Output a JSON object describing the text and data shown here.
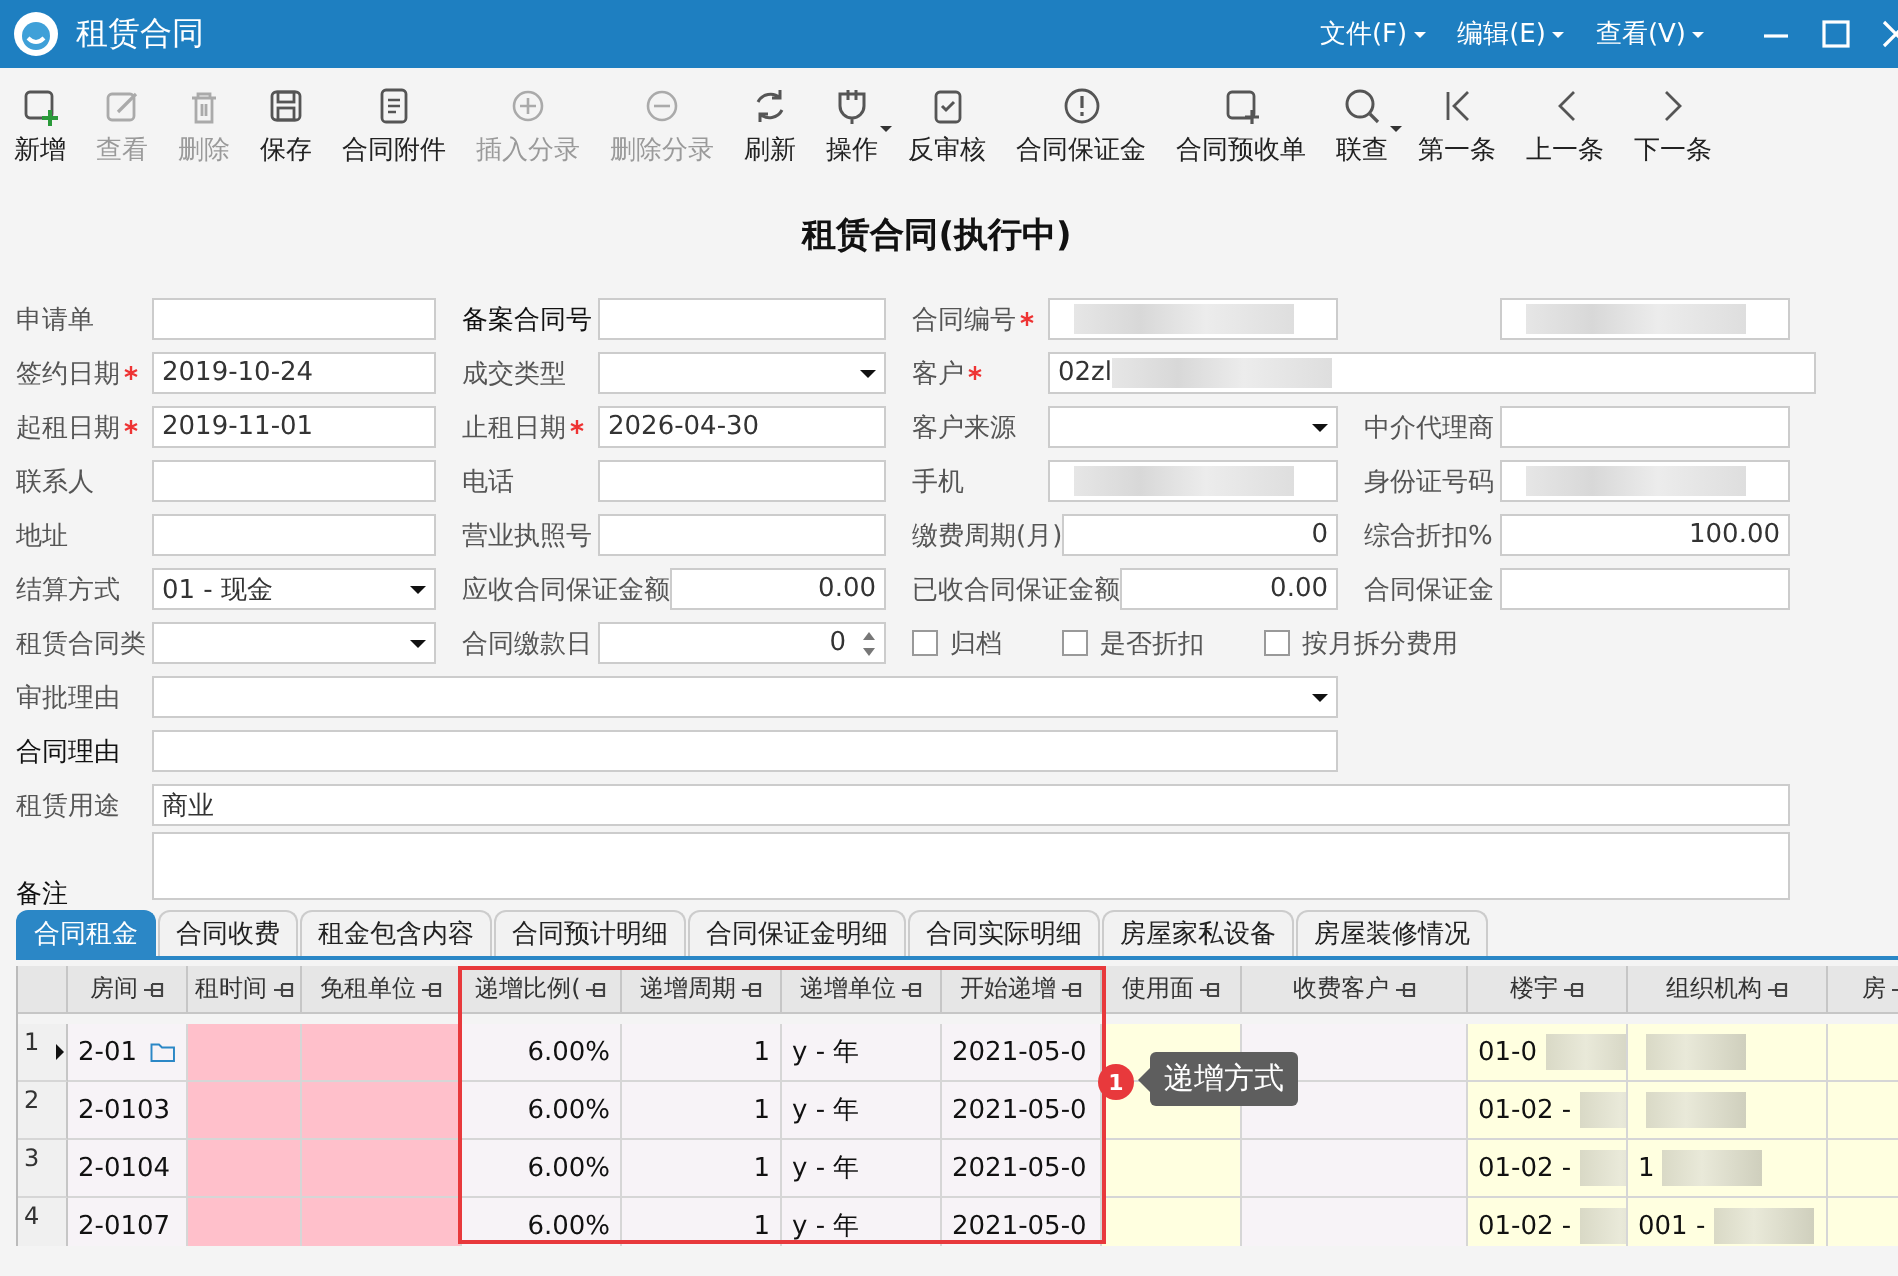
{
  "window": {
    "title": "租赁合同",
    "menus": [
      "文件(F)",
      "编辑(E)",
      "查看(V)"
    ]
  },
  "toolbar": [
    {
      "label": "新增",
      "disabled": false,
      "dropdown": false
    },
    {
      "label": "查看",
      "disabled": true,
      "dropdown": false
    },
    {
      "label": "删除",
      "disabled": true,
      "dropdown": false
    },
    {
      "label": "保存",
      "disabled": false,
      "dropdown": false
    },
    {
      "label": "合同附件",
      "disabled": false,
      "dropdown": false
    },
    {
      "label": "插入分录",
      "disabled": true,
      "dropdown": false
    },
    {
      "label": "删除分录",
      "disabled": true,
      "dropdown": false
    },
    {
      "label": "刷新",
      "disabled": false,
      "dropdown": false
    },
    {
      "label": "操作",
      "disabled": false,
      "dropdown": true
    },
    {
      "label": "反审核",
      "disabled": false,
      "dropdown": false
    },
    {
      "label": "合同保证金",
      "disabled": false,
      "dropdown": false
    },
    {
      "label": "合同预收单",
      "disabled": false,
      "dropdown": false
    },
    {
      "label": "联查",
      "disabled": false,
      "dropdown": true
    },
    {
      "label": "第一条",
      "disabled": false,
      "dropdown": false
    },
    {
      "label": "上一条",
      "disabled": false,
      "dropdown": false
    },
    {
      "label": "下一条",
      "disabled": false,
      "dropdown": false
    }
  ],
  "heading": "租赁合同(执行中)",
  "form": [
    [
      {
        "label": "申请单",
        "kind": "text"
      },
      {
        "label": "备案合同号",
        "kind": "text",
        "strong": true
      },
      {
        "label": "合同编号",
        "kind": "text",
        "required": true,
        "redacted": true
      },
      {
        "kind": "text",
        "redacted": true
      }
    ],
    [
      {
        "label": "签约日期",
        "kind": "text",
        "required": true,
        "value": "2019-10-24"
      },
      {
        "label": "成交类型",
        "kind": "select"
      },
      {
        "label": "客户",
        "kind": "text",
        "required": true,
        "value": "02zl",
        "redacted": true
      }
    ],
    [
      {
        "label": "起租日期",
        "kind": "text",
        "required": true,
        "value": "2019-11-01"
      },
      {
        "label": "止租日期",
        "kind": "text",
        "required": true,
        "value": "2026-04-30"
      },
      {
        "label": "客户来源",
        "kind": "select"
      },
      {
        "label": "中介代理商",
        "kind": "text"
      }
    ],
    [
      {
        "label": "联系人",
        "kind": "text"
      },
      {
        "label": "电话",
        "kind": "text"
      },
      {
        "label": "手机",
        "kind": "text",
        "redacted": true
      },
      {
        "label": "身份证号码",
        "kind": "text",
        "redacted": true
      }
    ],
    [
      {
        "label": "地址",
        "kind": "text"
      },
      {
        "label": "营业执照号",
        "kind": "text"
      },
      {
        "label": "缴费周期(月)",
        "kind": "number",
        "value": "0"
      },
      {
        "label": "综合折扣%",
        "kind": "number",
        "value": "100.00"
      }
    ],
    [
      {
        "label": "结算方式",
        "kind": "select",
        "value": "01 - 现金"
      },
      {
        "label": "应收合同保证金额",
        "kind": "number",
        "value": "0.00"
      },
      {
        "label": "已收合同保证金额",
        "kind": "number",
        "value": "0.00"
      },
      {
        "label": "合同保证金",
        "kind": "text"
      }
    ],
    [
      {
        "label": "租赁合同类",
        "kind": "select"
      },
      {
        "label": "合同缴款日",
        "kind": "spin",
        "value": "0"
      },
      {
        "kind": "checks",
        "items": [
          {
            "label": "归档",
            "checked": false
          },
          {
            "label": "是否折扣",
            "checked": false
          },
          {
            "label": "按月拆分费用",
            "checked": false
          }
        ]
      }
    ],
    [
      {
        "label": "审批理由",
        "kind": "select"
      }
    ],
    [
      {
        "label": "合同理由",
        "kind": "text",
        "strong": true
      }
    ],
    [
      {
        "label": "租赁用途",
        "kind": "text",
        "value": "商业"
      }
    ],
    [
      {
        "label": "备注",
        "kind": "textarea",
        "strong": true
      }
    ]
  ],
  "tabs": [
    {
      "label": "合同租金",
      "selected": true
    },
    {
      "label": "合同收费",
      "selected": false
    },
    {
      "label": "租金包含内容",
      "selected": false
    },
    {
      "label": "合同预计明细",
      "selected": false
    },
    {
      "label": "合同保证金明细",
      "selected": false
    },
    {
      "label": "合同实际明细",
      "selected": false
    },
    {
      "label": "房屋家私设备",
      "selected": false
    },
    {
      "label": "房屋装修情况",
      "selected": false
    }
  ],
  "grid": {
    "columns": [
      {
        "header": "房间",
        "color": "#f7f3f7"
      },
      {
        "header": "租时间",
        "color": "#ffc0cb"
      },
      {
        "header": "免租单位",
        "color": "#ffc0cb"
      },
      {
        "header": "递增比例(",
        "color": "#f7f3f7"
      },
      {
        "header": "递增周期",
        "color": "#f7f3f7"
      },
      {
        "header": "递增单位",
        "color": "#f7f3f7"
      },
      {
        "header": "开始递增",
        "color": "#f7f3f7"
      },
      {
        "header": "使用面",
        "color": "#ffffe0"
      },
      {
        "header": "收费客户",
        "color": "#f7f3f7"
      },
      {
        "header": "楼宇",
        "color": "#ffffe0"
      },
      {
        "header": "组织机构",
        "color": "#ffffe0"
      },
      {
        "header": "房",
        "color": "#ffffe0"
      }
    ],
    "rows": [
      {
        "number": "1",
        "current": true,
        "cells": [
          "2-01",
          "",
          "",
          "6.00%",
          "1",
          "y - 年",
          "2021-05-0",
          "",
          "",
          "01-0",
          "",
          ""
        ],
        "folder": true
      },
      {
        "number": "2",
        "current": false,
        "cells": [
          "2-0103",
          "",
          "",
          "6.00%",
          "1",
          "y - 年",
          "2021-05-0",
          "",
          "",
          "01-02 -",
          "",
          ""
        ],
        "folder": false
      },
      {
        "number": "3",
        "current": false,
        "cells": [
          "2-0104",
          "",
          "",
          "6.00%",
          "1",
          "y - 年",
          "2021-05-0",
          "",
          "",
          "01-02 -",
          "1",
          ""
        ],
        "folder": false
      },
      {
        "number": "4",
        "current": false,
        "cells": [
          "2-0107",
          "",
          "",
          "6.00%",
          "1",
          "y - 年",
          "2021-05-0",
          "",
          "",
          "01-02 -",
          "001 -",
          ""
        ],
        "folder": false
      }
    ],
    "annotation": {
      "badge": "1",
      "text": "递增方式"
    }
  }
}
